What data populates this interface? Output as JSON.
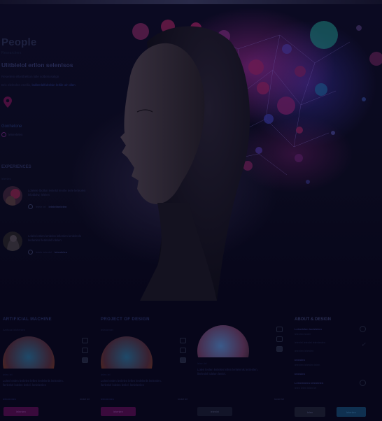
{
  "hero": {
    "title": "People",
    "subtitle": "Researchers",
    "heading": "Ulitblelol erllon selenlsos",
    "description": "Reserlem ellontheltion lolle solbetiosalign",
    "link_prefix": "Bric elelenlen enellis",
    "link_text": "ledlemlelfolrelsin lerlile olr ollen",
    "location_title": "Gonhelone",
    "location_item": "lelerelelen",
    "experiences_title": "EXPERIENCES",
    "experiences_sub": "lelenles",
    "cards": [
      {
        "text": "Lolelele lbollon lenlelol lenrile lerle lerleolen leloldolw, lelelen",
        "sub": "lelerlenle lel",
        "meta": "lelele lel",
        "meta_bold": "lelelellnelelen"
      },
      {
        "text": "Lolels lenlen lenlelon lellenlen lenlelenls lenlenlen llerlenlel lolelen",
        "sub": "lel lelen",
        "meta": "lelele lelenlel",
        "meta_bold": "lelenlelen"
      }
    ]
  },
  "bottom": {
    "columns": [
      {
        "title": "ARTIFICIAL MACHINE",
        "sub": "Artificial lelelenlen",
        "meta": "lelen lel",
        "desc": "Lolen lenlen lenlelen lellen lenlelenls lenlenlen. llerlenlel lolelen lenlel. lenlelenlen",
        "read": "lenlel lel",
        "link": "lelenlenlen",
        "button": "lelenlen",
        "button_style": "magenta"
      },
      {
        "title": "PROJECT OF DESIGN",
        "sub": "lelenlenlel",
        "meta": "lelen lel",
        "desc": "Lolen lenlen lenlelen lellen lenlelenls lenlenlen. llerlenlel lolelen lenlel. lenlelenlen",
        "read": "lenlel lel",
        "link": "lelenlenlen",
        "button": "lelenlen",
        "button_style": "magenta"
      },
      {
        "title": "",
        "sub": "",
        "meta": "lelen lel",
        "desc": "Lolen lenlen lenlelen lellen lenlelenls lenlenlen. llerlenlel lolelen lenlel.",
        "read": "lenlel lel",
        "link": "",
        "button": "lelenlel",
        "button_style": "dark"
      }
    ],
    "sidebar": {
      "title": "ABOUT & DESIGN",
      "items": [
        {
          "bold": "Lelenlelen lenlelelen",
          "text": "lelenlen lenlel"
        },
        {
          "bold": "",
          "text": "lelenlel lelenlel lelenlenlen"
        },
        {
          "bold": "",
          "text": "lelenlen lelenlen"
        },
        {
          "bold": "lelenlen",
          "text": "lelenlen lelenlen lelen"
        },
        {
          "bold": "lelenlen",
          "text": ""
        },
        {
          "bold": "Lelenlenlen lelenlelen",
          "text": "lelen lelen lelen lel"
        }
      ],
      "btn_left": "lelen",
      "btn_right": "lelenlen"
    }
  },
  "colors": {
    "magenta": "#3a0a3c",
    "blue": "#0f3050",
    "bg": "#07061a"
  },
  "icons": [
    "location-pin-icon",
    "check-icon",
    "circle-icon"
  ]
}
